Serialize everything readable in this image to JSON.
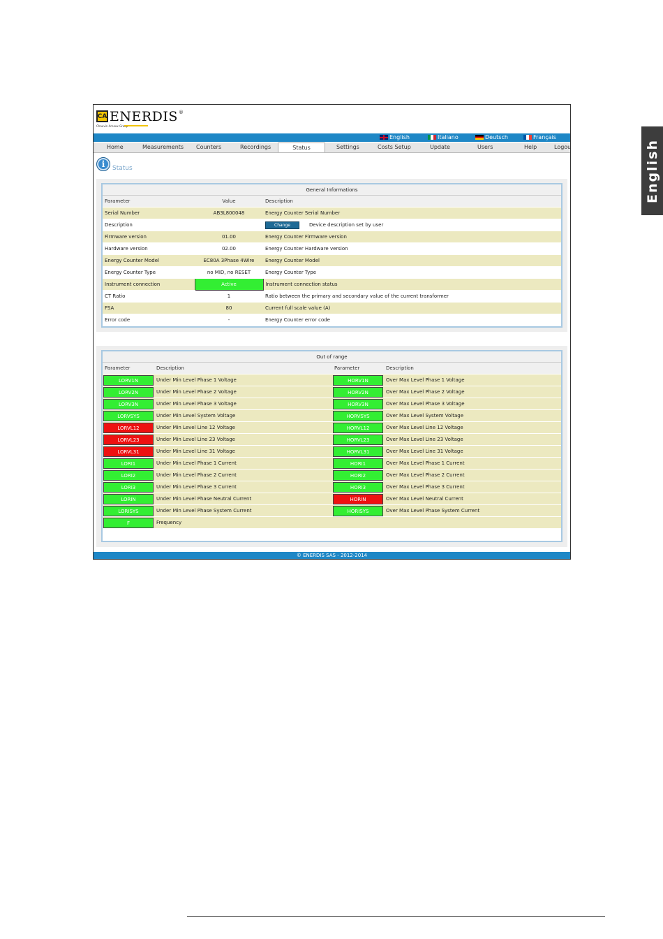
{
  "side_tab": {
    "label": "English"
  },
  "brand": {
    "name": "ENERDIS",
    "registered": "®",
    "tagline": "Chauvin Arnoux Group"
  },
  "languages": [
    {
      "label": "English",
      "flag": "flag-en"
    },
    {
      "label": "Italiano",
      "flag": "flag-it"
    },
    {
      "label": "Deutsch",
      "flag": "flag-de"
    },
    {
      "label": "Français",
      "flag": "flag-fr"
    }
  ],
  "nav": [
    "Home",
    "Measurements",
    "Counters",
    "Recordings",
    "Status",
    "Settings",
    "Costs Setup",
    "Update",
    "Users",
    "Help",
    "Logout"
  ],
  "page_title": "Status",
  "general": {
    "title": "General Informations",
    "headers": [
      "Parameter",
      "Value",
      "Description"
    ],
    "change_label": "Change",
    "rows": [
      {
        "param": "Serial Number",
        "value": "AB3L800048",
        "desc": "Energy Counter Serial Number"
      },
      {
        "param": "Description",
        "value": "",
        "desc": "Device description set by user"
      },
      {
        "param": "Firmware version",
        "value": "01.00",
        "desc": "Energy Counter Firmware version"
      },
      {
        "param": "Hardware version",
        "value": "02.00",
        "desc": "Energy Counter Hardware version"
      },
      {
        "param": "Energy Counter Model",
        "value": "EC80A 3Phase 4Wire",
        "desc": "Energy Counter Model"
      },
      {
        "param": "Energy Counter Type",
        "value": "no MID, no RESET",
        "desc": "Energy Counter Type"
      },
      {
        "param": "Instrument connection",
        "value": "Active",
        "desc": "Instrument connection status"
      },
      {
        "param": "CT Ratio",
        "value": "1",
        "desc": "Ratio between the primary and secondary value of the current transformer"
      },
      {
        "param": "FSA",
        "value": "80",
        "desc": "Current full scale value (A)"
      },
      {
        "param": "Error code",
        "value": "-",
        "desc": "Energy Counter error code"
      }
    ]
  },
  "out_of_range": {
    "title": "Out of range",
    "headers": [
      "Parameter",
      "Description",
      "Parameter",
      "Description"
    ],
    "rows": [
      {
        "lp": "LORV1N",
        "lc": "green",
        "ld": "Under Min Level Phase 1 Voltage",
        "rp": "HORV1N",
        "rc": "green",
        "rd": "Over Max Level Phase 1 Voltage"
      },
      {
        "lp": "LORV2N",
        "lc": "green",
        "ld": "Under Min Level Phase 2 Voltage",
        "rp": "HORV2N",
        "rc": "green",
        "rd": "Over Max Level Phase 2 Voltage"
      },
      {
        "lp": "LORV3N",
        "lc": "green",
        "ld": "Under Min Level Phase 3 Voltage",
        "rp": "HORV3N",
        "rc": "green",
        "rd": "Over Max Level Phase 3 Voltage"
      },
      {
        "lp": "LORVSYS",
        "lc": "green",
        "ld": "Under Min Level System Voltage",
        "rp": "HORVSYS",
        "rc": "green",
        "rd": "Over Max Level System Voltage"
      },
      {
        "lp": "LORVL12",
        "lc": "red",
        "ld": "Under Min Level Line 12 Voltage",
        "rp": "HORVL12",
        "rc": "green",
        "rd": "Over Max Level Line 12 Voltage"
      },
      {
        "lp": "LORVL23",
        "lc": "red",
        "ld": "Under Min Level Line 23 Voltage",
        "rp": "HORVL23",
        "rc": "green",
        "rd": "Over Max Level Line 23 Voltage"
      },
      {
        "lp": "LORVL31",
        "lc": "red",
        "ld": "Under Min Level Line 31 Voltage",
        "rp": "HORVL31",
        "rc": "green",
        "rd": "Over Max Level Line 31 Voltage"
      },
      {
        "lp": "LORI1",
        "lc": "green",
        "ld": "Under Min Level Phase 1 Current",
        "rp": "HORI1",
        "rc": "green",
        "rd": "Over Max Level Phase 1 Current"
      },
      {
        "lp": "LORI2",
        "lc": "green",
        "ld": "Under Min Level Phase 2 Current",
        "rp": "HORI2",
        "rc": "green",
        "rd": "Over Max Level Phase 2 Current"
      },
      {
        "lp": "LORI3",
        "lc": "green",
        "ld": "Under Min Level Phase 3 Current",
        "rp": "HORI3",
        "rc": "green",
        "rd": "Over Max Level Phase 3 Current"
      },
      {
        "lp": "LORIN",
        "lc": "green",
        "ld": "Under Min Level Phase Neutral Current",
        "rp": "HORIN",
        "rc": "red",
        "rd": "Over Max Level Neutral Current"
      },
      {
        "lp": "LORISYS",
        "lc": "green",
        "ld": "Under Min Level Phase System Current",
        "rp": "HORISYS",
        "rc": "green",
        "rd": "Over Max Level Phase System Current"
      },
      {
        "lp": "F",
        "lc": "green",
        "ld": "Frequency",
        "rp": "",
        "rc": "",
        "rd": ""
      }
    ]
  },
  "footer": "© ENERDIS SAS - 2012-2014"
}
